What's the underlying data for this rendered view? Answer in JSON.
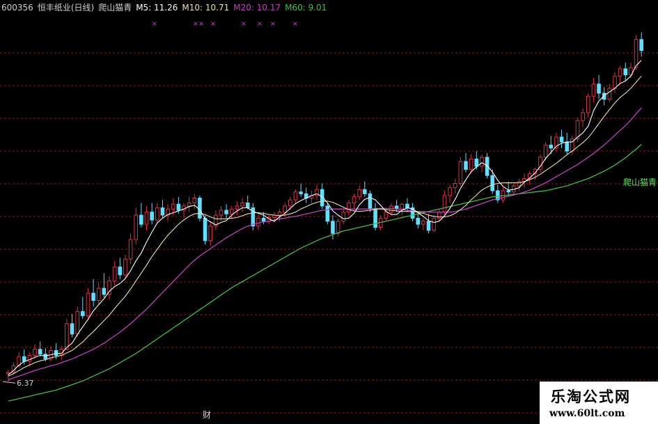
{
  "header": {
    "code": "600356",
    "name": "恒丰纸业(日线)",
    "indicator": "爬山猫青",
    "ma5": "M5: 11.26",
    "ma10": "M10: 10.71",
    "ma20": "M20: 10.17",
    "ma60": "M60: 9.01"
  },
  "colors": {
    "up": "#e0304a",
    "down": "#5fe0ff",
    "ma5": "#ffffff",
    "ma10": "#e8e0b0",
    "ma20": "#c040c0",
    "ma60": "#40c040",
    "grid": "#8a1a1a",
    "text_label": "#cfcfcf",
    "indicator_label": "#60e060"
  },
  "chart_data": {
    "type": "candlestick",
    "ylim": [
      5.8,
      12.4
    ],
    "low_label": "6.37",
    "line_label": "爬山猫青",
    "bottom_marker": "财",
    "markers_top": [
      "×",
      "××",
      "×",
      "×",
      "×",
      "×",
      "×",
      "×"
    ],
    "candles": [
      [
        6.5,
        6.56,
        6.37,
        6.52
      ],
      [
        6.52,
        6.68,
        6.49,
        6.63
      ],
      [
        6.63,
        6.85,
        6.6,
        6.78
      ],
      [
        6.78,
        6.9,
        6.65,
        6.7
      ],
      [
        6.7,
        6.84,
        6.62,
        6.8
      ],
      [
        6.8,
        6.98,
        6.75,
        6.9
      ],
      [
        6.9,
        7.03,
        6.78,
        6.82
      ],
      [
        6.82,
        6.92,
        6.7,
        6.74
      ],
      [
        6.74,
        6.95,
        6.7,
        6.88
      ],
      [
        6.88,
        7.0,
        6.74,
        6.8
      ],
      [
        6.8,
        6.95,
        6.72,
        6.9
      ],
      [
        6.9,
        7.4,
        6.88,
        7.32
      ],
      [
        7.32,
        7.48,
        7.1,
        7.15
      ],
      [
        7.15,
        7.6,
        7.1,
        7.52
      ],
      [
        7.52,
        7.76,
        7.4,
        7.45
      ],
      [
        7.45,
        7.9,
        7.4,
        7.82
      ],
      [
        7.82,
        8.05,
        7.6,
        7.7
      ],
      [
        7.7,
        8.0,
        7.62,
        7.9
      ],
      [
        7.9,
        8.15,
        7.75,
        7.8
      ],
      [
        7.8,
        8.1,
        7.72,
        8.02
      ],
      [
        8.02,
        8.35,
        7.95,
        8.25
      ],
      [
        8.25,
        8.4,
        8.05,
        8.12
      ],
      [
        8.12,
        8.45,
        8.05,
        8.38
      ],
      [
        8.38,
        8.8,
        8.3,
        8.7
      ],
      [
        8.7,
        9.22,
        8.62,
        9.1
      ],
      [
        9.1,
        9.3,
        8.9,
        8.95
      ],
      [
        8.95,
        9.25,
        8.85,
        9.15
      ],
      [
        9.15,
        9.3,
        8.95,
        9.02
      ],
      [
        9.02,
        9.3,
        8.98,
        9.22
      ],
      [
        9.22,
        9.35,
        9.05,
        9.1
      ],
      [
        9.1,
        9.28,
        9.0,
        9.2
      ],
      [
        9.2,
        9.38,
        9.1,
        9.28
      ],
      [
        9.28,
        9.4,
        9.12,
        9.18
      ],
      [
        9.18,
        9.3,
        9.05,
        9.25
      ],
      [
        9.25,
        9.4,
        9.15,
        9.3
      ],
      [
        9.3,
        9.45,
        9.2,
        9.38
      ],
      [
        9.38,
        9.42,
        9.0,
        9.05
      ],
      [
        9.05,
        9.1,
        8.62,
        8.68
      ],
      [
        8.68,
        9.0,
        8.6,
        8.92
      ],
      [
        8.92,
        9.18,
        8.85,
        9.1
      ],
      [
        9.1,
        9.25,
        9.0,
        9.18
      ],
      [
        9.18,
        9.28,
        9.05,
        9.12
      ],
      [
        9.12,
        9.25,
        9.05,
        9.2
      ],
      [
        9.2,
        9.32,
        9.1,
        9.25
      ],
      [
        9.25,
        9.38,
        9.15,
        9.3
      ],
      [
        9.3,
        9.42,
        9.2,
        9.22
      ],
      [
        9.22,
        9.3,
        8.85,
        8.92
      ],
      [
        8.92,
        9.1,
        8.85,
        9.05
      ],
      [
        9.05,
        9.15,
        8.95,
        9.0
      ],
      [
        9.0,
        9.1,
        8.95,
        9.06
      ],
      [
        9.06,
        9.15,
        8.98,
        9.1
      ],
      [
        9.1,
        9.2,
        9.0,
        9.15
      ],
      [
        9.15,
        9.3,
        9.08,
        9.25
      ],
      [
        9.25,
        9.4,
        9.18,
        9.35
      ],
      [
        9.35,
        9.52,
        9.3,
        9.48
      ],
      [
        9.48,
        9.62,
        9.4,
        9.45
      ],
      [
        9.45,
        9.55,
        9.3,
        9.38
      ],
      [
        9.38,
        9.5,
        9.3,
        9.42
      ],
      [
        9.42,
        9.6,
        9.35,
        9.52
      ],
      [
        9.52,
        9.62,
        9.2,
        9.25
      ],
      [
        9.25,
        9.3,
        8.95,
        9.0
      ],
      [
        9.0,
        9.1,
        8.7,
        8.8
      ],
      [
        8.8,
        9.05,
        8.75,
        9.0
      ],
      [
        9.0,
        9.2,
        8.95,
        9.15
      ],
      [
        9.15,
        9.35,
        9.1,
        9.3
      ],
      [
        9.3,
        9.45,
        9.2,
        9.4
      ],
      [
        9.4,
        9.58,
        9.35,
        9.52
      ],
      [
        9.52,
        9.65,
        9.4,
        9.45
      ],
      [
        9.45,
        9.5,
        9.15,
        9.2
      ],
      [
        9.2,
        9.3,
        8.85,
        8.9
      ],
      [
        8.9,
        9.1,
        8.85,
        9.05
      ],
      [
        9.05,
        9.2,
        9.0,
        9.15
      ],
      [
        9.15,
        9.3,
        9.1,
        9.25
      ],
      [
        9.25,
        9.35,
        9.15,
        9.2
      ],
      [
        9.2,
        9.3,
        9.1,
        9.28
      ],
      [
        9.28,
        9.38,
        9.15,
        9.22
      ],
      [
        9.22,
        9.3,
        9.0,
        9.05
      ],
      [
        9.05,
        9.12,
        8.88,
        8.95
      ],
      [
        8.95,
        9.05,
        8.85,
        9.0
      ],
      [
        9.0,
        9.12,
        8.8,
        8.85
      ],
      [
        8.85,
        9.1,
        8.82,
        9.05
      ],
      [
        9.05,
        9.2,
        9.0,
        9.15
      ],
      [
        9.15,
        9.5,
        9.1,
        9.42
      ],
      [
        9.42,
        9.6,
        9.3,
        9.55
      ],
      [
        9.55,
        9.7,
        9.45,
        9.62
      ],
      [
        9.62,
        10.05,
        9.58,
        9.98
      ],
      [
        9.98,
        10.12,
        9.8,
        9.85
      ],
      [
        9.85,
        10.1,
        9.78,
        10.02
      ],
      [
        10.02,
        10.15,
        9.85,
        9.9
      ],
      [
        9.9,
        10.1,
        9.8,
        10.05
      ],
      [
        10.05,
        10.12,
        9.7,
        9.75
      ],
      [
        9.75,
        9.85,
        9.45,
        9.5
      ],
      [
        9.5,
        9.6,
        9.3,
        9.35
      ],
      [
        9.35,
        9.55,
        9.3,
        9.5
      ],
      [
        9.5,
        9.65,
        9.4,
        9.48
      ],
      [
        9.48,
        9.62,
        9.42,
        9.58
      ],
      [
        9.58,
        9.7,
        9.5,
        9.65
      ],
      [
        9.65,
        9.78,
        9.55,
        9.7
      ],
      [
        9.7,
        9.82,
        9.6,
        9.78
      ],
      [
        9.78,
        9.88,
        9.68,
        9.85
      ],
      [
        9.85,
        10.1,
        9.8,
        10.05
      ],
      [
        10.05,
        10.3,
        10.0,
        10.25
      ],
      [
        10.25,
        10.4,
        10.1,
        10.2
      ],
      [
        10.2,
        10.45,
        10.15,
        10.38
      ],
      [
        10.38,
        10.5,
        10.2,
        10.3
      ],
      [
        10.3,
        10.45,
        10.1,
        10.15
      ],
      [
        10.15,
        10.4,
        10.1,
        10.35
      ],
      [
        10.35,
        10.7,
        10.3,
        10.65
      ],
      [
        10.65,
        10.85,
        10.55,
        10.78
      ],
      [
        10.78,
        11.1,
        10.7,
        11.05
      ],
      [
        11.05,
        11.35,
        10.95,
        11.25
      ],
      [
        11.25,
        11.4,
        11.0,
        11.1
      ],
      [
        11.1,
        11.2,
        10.9,
        11.0
      ],
      [
        11.0,
        11.25,
        10.95,
        11.18
      ],
      [
        11.18,
        11.45,
        11.1,
        11.38
      ],
      [
        11.38,
        11.55,
        11.25,
        11.5
      ],
      [
        11.5,
        11.6,
        11.3,
        11.4
      ],
      [
        11.4,
        11.6,
        11.35,
        11.52
      ],
      [
        11.52,
        12.05,
        11.48,
        11.98
      ],
      [
        11.98,
        12.1,
        11.7,
        11.8
      ]
    ],
    "ma5": [
      6.48,
      6.55,
      6.64,
      6.7,
      6.73,
      6.77,
      6.8,
      6.79,
      6.81,
      6.83,
      6.83,
      6.93,
      7.0,
      7.14,
      7.27,
      7.39,
      7.53,
      7.63,
      7.73,
      7.85,
      7.93,
      7.98,
      8.06,
      8.19,
      8.35,
      8.48,
      8.66,
      8.82,
      8.97,
      9.05,
      9.11,
      9.14,
      9.17,
      9.2,
      9.24,
      9.26,
      9.19,
      9.04,
      8.99,
      8.94,
      8.98,
      9.01,
      9.1,
      9.17,
      9.22,
      9.22,
      9.16,
      9.13,
      9.1,
      9.04,
      9.0,
      9.07,
      9.13,
      9.21,
      9.29,
      9.34,
      9.38,
      9.42,
      9.45,
      9.4,
      9.3,
      9.17,
      9.1,
      9.04,
      9.05,
      9.13,
      9.27,
      9.36,
      9.39,
      9.35,
      9.26,
      9.16,
      9.11,
      9.11,
      9.18,
      9.22,
      9.2,
      9.14,
      9.08,
      9.01,
      8.98,
      9.0,
      9.09,
      9.21,
      9.36,
      9.54,
      9.68,
      9.81,
      9.89,
      9.96,
      9.91,
      9.81,
      9.67,
      9.57,
      9.51,
      9.52,
      9.55,
      9.64,
      9.71,
      9.79,
      9.9,
      10.03,
      10.13,
      10.23,
      10.28,
      10.3,
      10.3,
      10.38,
      10.45,
      10.56,
      10.81,
      10.97,
      11.06,
      11.12,
      11.18,
      11.26,
      11.3,
      11.38,
      11.55,
      11.64
    ],
    "ma10": [
      6.46,
      6.5,
      6.55,
      6.6,
      6.64,
      6.68,
      6.71,
      6.73,
      6.76,
      6.78,
      6.8,
      6.84,
      6.88,
      6.95,
      7.02,
      7.11,
      7.19,
      7.28,
      7.37,
      7.46,
      7.57,
      7.67,
      7.77,
      7.89,
      8.02,
      8.15,
      8.28,
      8.42,
      8.54,
      8.66,
      8.77,
      8.86,
      8.95,
      9.02,
      9.08,
      9.12,
      9.13,
      9.11,
      9.07,
      9.04,
      9.04,
      9.04,
      9.05,
      9.06,
      9.09,
      9.12,
      9.14,
      9.14,
      9.13,
      9.11,
      9.1,
      9.09,
      9.1,
      9.12,
      9.15,
      9.2,
      9.24,
      9.28,
      9.31,
      9.33,
      9.33,
      9.31,
      9.27,
      9.23,
      9.19,
      9.17,
      9.16,
      9.17,
      9.18,
      9.2,
      9.2,
      9.19,
      9.18,
      9.17,
      9.16,
      9.16,
      9.16,
      9.15,
      9.13,
      9.1,
      9.08,
      9.07,
      9.07,
      9.09,
      9.13,
      9.19,
      9.26,
      9.35,
      9.43,
      9.51,
      9.56,
      9.6,
      9.62,
      9.63,
      9.63,
      9.63,
      9.63,
      9.65,
      9.68,
      9.72,
      9.77,
      9.83,
      9.89,
      9.95,
      10.02,
      10.09,
      10.15,
      10.22,
      10.29,
      10.37,
      10.48,
      10.6,
      10.72,
      10.83,
      10.94,
      11.03,
      11.1,
      11.18,
      11.28,
      11.38
    ],
    "ma20": [
      6.4,
      6.43,
      6.46,
      6.49,
      6.52,
      6.55,
      6.58,
      6.6,
      6.63,
      6.65,
      6.68,
      6.71,
      6.74,
      6.78,
      6.82,
      6.86,
      6.9,
      6.95,
      7.0,
      7.06,
      7.12,
      7.18,
      7.25,
      7.32,
      7.4,
      7.48,
      7.56,
      7.65,
      7.74,
      7.83,
      7.92,
      8.01,
      8.1,
      8.19,
      8.28,
      8.36,
      8.43,
      8.49,
      8.55,
      8.61,
      8.67,
      8.73,
      8.78,
      8.83,
      8.88,
      8.92,
      8.95,
      8.97,
      8.99,
      9.0,
      9.02,
      9.04,
      9.05,
      9.07,
      9.08,
      9.1,
      9.12,
      9.14,
      9.16,
      9.18,
      9.19,
      9.2,
      9.2,
      9.2,
      9.2,
      9.2,
      9.2,
      9.2,
      9.2,
      9.21,
      9.21,
      9.21,
      9.21,
      9.2,
      9.19,
      9.18,
      9.17,
      9.16,
      9.16,
      9.15,
      9.15,
      9.15,
      9.15,
      9.15,
      9.16,
      9.18,
      9.2,
      9.23,
      9.26,
      9.29,
      9.32,
      9.35,
      9.37,
      9.39,
      9.41,
      9.43,
      9.45,
      9.48,
      9.51,
      9.55,
      9.59,
      9.63,
      9.68,
      9.73,
      9.78,
      9.83,
      9.88,
      9.93,
      9.99,
      10.05,
      10.11,
      10.18,
      10.25,
      10.33,
      10.41,
      10.49,
      10.57,
      10.66,
      10.76,
      10.86
    ],
    "ma60": [
      6.05,
      6.07,
      6.09,
      6.11,
      6.13,
      6.15,
      6.17,
      6.19,
      6.21,
      6.23,
      6.26,
      6.29,
      6.32,
      6.35,
      6.38,
      6.42,
      6.46,
      6.5,
      6.54,
      6.58,
      6.63,
      6.68,
      6.73,
      6.78,
      6.83,
      6.89,
      6.95,
      7.01,
      7.07,
      7.13,
      7.19,
      7.25,
      7.31,
      7.37,
      7.43,
      7.49,
      7.55,
      7.61,
      7.67,
      7.73,
      7.79,
      7.85,
      7.91,
      7.96,
      8.01,
      8.06,
      8.11,
      8.16,
      8.21,
      8.26,
      8.31,
      8.36,
      8.41,
      8.46,
      8.51,
      8.56,
      8.6,
      8.64,
      8.68,
      8.72,
      8.75,
      8.78,
      8.81,
      8.84,
      8.86,
      8.88,
      8.9,
      8.92,
      8.94,
      8.96,
      8.98,
      9.0,
      9.02,
      9.04,
      9.06,
      9.08,
      9.1,
      9.12,
      9.14,
      9.16,
      9.18,
      9.2,
      9.22,
      9.24,
      9.26,
      9.28,
      9.3,
      9.32,
      9.34,
      9.36,
      9.38,
      9.4,
      9.41,
      9.42,
      9.43,
      9.44,
      9.45,
      9.46,
      9.47,
      9.48,
      9.49,
      9.5,
      9.52,
      9.54,
      9.56,
      9.58,
      9.61,
      9.64,
      9.67,
      9.7,
      9.74,
      9.78,
      9.82,
      9.87,
      9.92,
      9.98,
      10.04,
      10.11,
      10.18,
      10.26
    ]
  },
  "watermark": {
    "title": "乐淘公式网",
    "url": "www.60lt.com"
  }
}
